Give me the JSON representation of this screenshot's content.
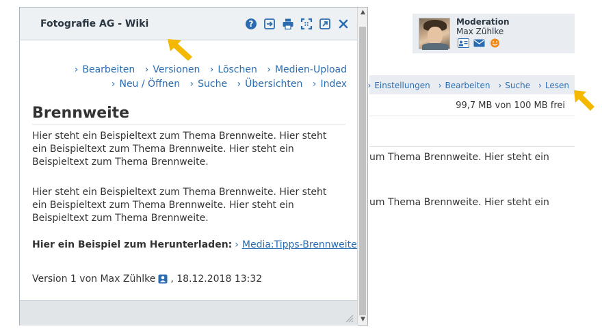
{
  "moderation": {
    "title": "Moderation",
    "name": "Max Zühlke",
    "icons": [
      "vcard-icon",
      "mail-icon",
      "smiley-icon"
    ]
  },
  "background": {
    "nav_partial": "",
    "nav_items": [
      "Einstellungen",
      "Bearbeiten",
      "Suche",
      "Lesen"
    ],
    "storage": "99,7 MB von 100 MB frei",
    "text_line_1": "um Thema Brennweite. Hier steht ein",
    "text_line_2": "um Thema Brennweite. Hier steht ein"
  },
  "dialog": {
    "title": "Fotografie AG - Wiki",
    "toolbar": [
      "help-icon",
      "export-icon",
      "print-icon",
      "fullscreen-icon",
      "popout-icon",
      "close-icon"
    ],
    "nav": {
      "edit": "Bearbeiten",
      "versions": "Versionen",
      "delete": "Löschen",
      "media_upload": "Medien-Upload",
      "new_open": "Neu / Öffnen",
      "search": "Suche",
      "overviews": "Übersichten",
      "index": "Index"
    },
    "page_title": "Brennweite",
    "paragraph_1": "Hier steht ein Beispieltext zum Thema Brennweite. Hier steht ein Beispieltext zum Thema Brennweite. Hier steht ein Beispieltext zum Thema Brennweite.",
    "paragraph_2": "Hier steht ein Beispieltext zum Thema Brennweite. Hier steht ein Beispieltext zum Thema Brennweite. Hier steht ein Beispieltext zum Thema Brennweite.",
    "download_label": "Hier ein Beispiel zum Herunterladen:",
    "download_link": "Media:Tipps-Brennweite.pdf",
    "version_text": "Version 1 von Max Zühlke",
    "version_date": ", 18.12.2018 13:32"
  },
  "colors": {
    "link": "#2b6cb0",
    "arrow": "#f5b800",
    "header_bg": "#eef1f4",
    "smiley": "#f08a1c"
  }
}
